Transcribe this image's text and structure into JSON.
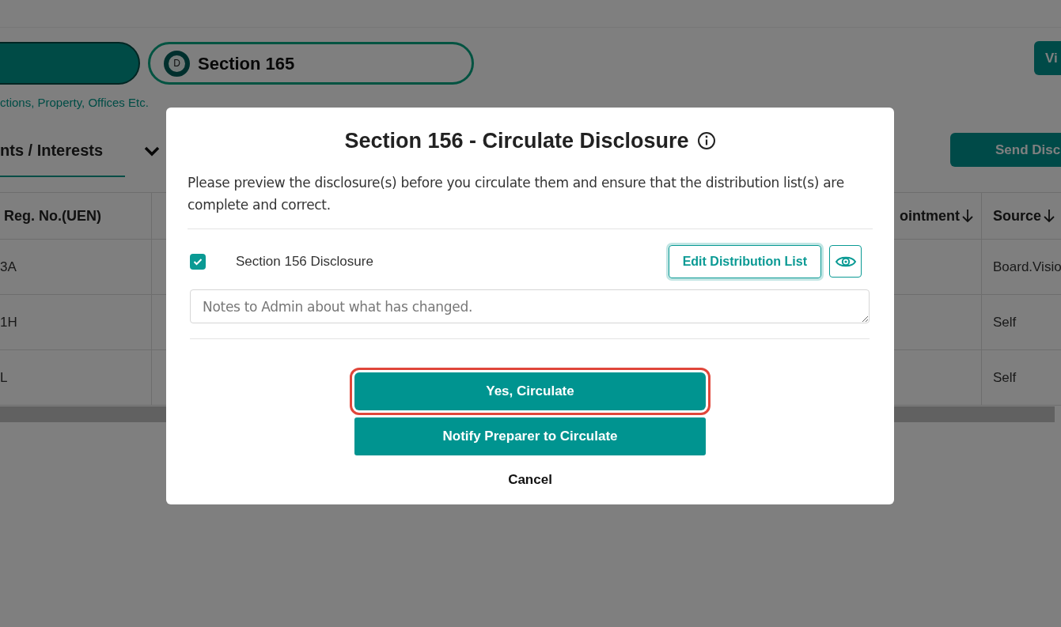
{
  "page": {
    "section_pills": [
      {
        "kind": "filled"
      },
      {
        "kind": "outline",
        "badge": "D",
        "label": "Section 165"
      }
    ],
    "subtitle": "ctions, Property, Offices Etc.",
    "view_button": "Vi",
    "tab": {
      "label": "nts / Interests",
      "selected": true
    },
    "send_button": "Send Disc",
    "table": {
      "columns": [
        "Reg. No.(UEN)",
        "ointment",
        "Source"
      ],
      "rows": [
        [
          "3A",
          "Board.Visio"
        ],
        [
          "1H",
          "Self"
        ],
        [
          "L",
          "Self"
        ]
      ]
    }
  },
  "dialog": {
    "title": "Section 156 - Circulate Disclosure",
    "message": "Please preview the disclosure(s) before you circulate them and ensure that the distribution list(s) are complete and correct.",
    "disclosures": [
      {
        "label": "Section 156 Disclosure",
        "checked": true,
        "edit_button": "Edit Distribution List"
      }
    ],
    "notes": {
      "placeholder": "Notes to Admin about what has changed."
    },
    "buttons": [
      {
        "label": "Yes, Circulate",
        "kind": "primary",
        "focused": true
      },
      {
        "label": "Notify Preparer to Circulate",
        "kind": "primary",
        "focused": false
      },
      {
        "label": "Cancel",
        "kind": "text",
        "focused": false
      }
    ]
  }
}
